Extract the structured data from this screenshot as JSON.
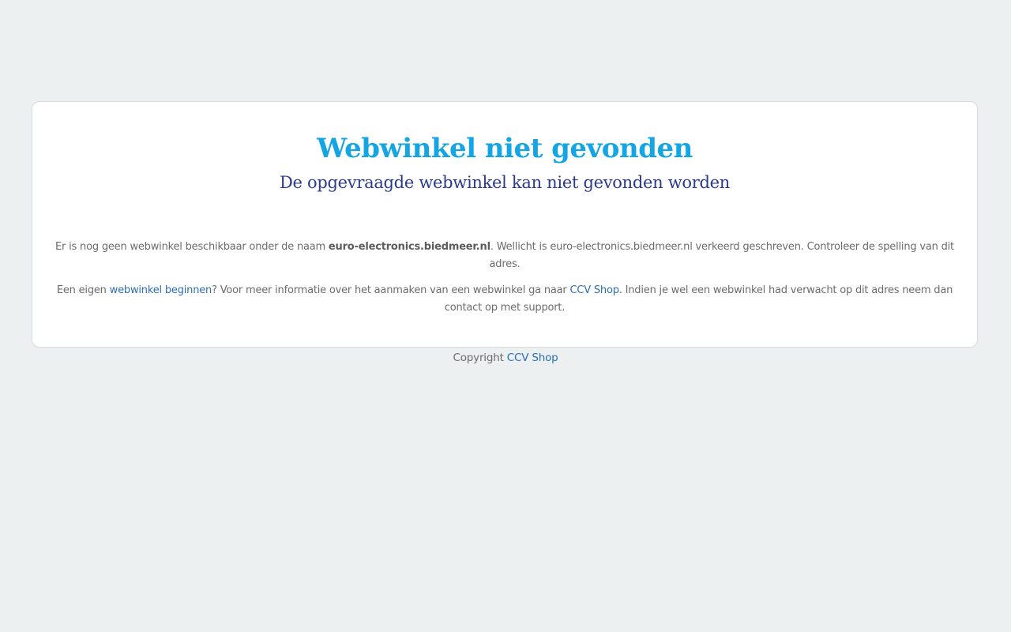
{
  "card": {
    "title": "Webwinkel niet gevonden",
    "subtitle": "De opgevraagde webwinkel kan niet gevonden worden",
    "paragraph1": {
      "part1": "Er is nog geen webwinkel beschikbaar onder de naam ",
      "domain": "euro-electronics.biedmeer.nl",
      "part2": ". Wellicht is euro-electronics.biedmeer.nl verkeerd geschreven. Controleer de spelling van dit adres."
    },
    "paragraph2": {
      "part1": "Een eigen ",
      "link1": "webwinkel beginnen",
      "part2": "? Voor meer informatie over het aanmaken van een webwinkel ga naar ",
      "link2": "CCV Shop",
      "part3": ". Indien je wel een webwinkel had verwacht op dit adres neem dan contact op met support."
    }
  },
  "footer": {
    "label": "Copyright ",
    "link": "CCV Shop"
  },
  "colors": {
    "background": "#ecf0f1",
    "title": "#14a5e4",
    "subtitle": "#2a3a8c",
    "link": "#2d6db5",
    "text": "#6b6b6b"
  }
}
